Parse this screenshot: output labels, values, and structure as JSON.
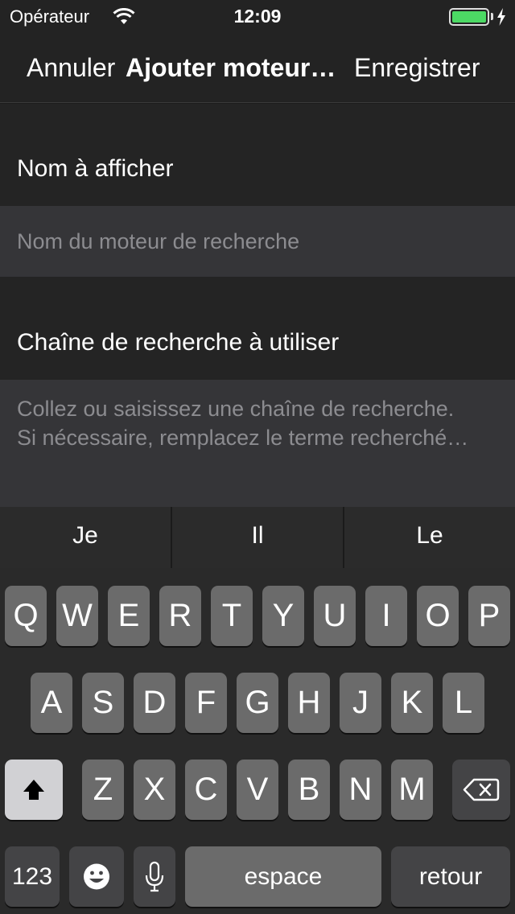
{
  "status_bar": {
    "carrier": "Opérateur",
    "time": "12:09",
    "wifi_icon": "wifi-icon",
    "battery_icon": "battery-icon",
    "charging_icon": "charging-bolt-icon",
    "battery_color": "#4cd964"
  },
  "nav": {
    "cancel_label": "Annuler",
    "title": "Ajouter moteur…",
    "save_label": "Enregistrer"
  },
  "form": {
    "name_section_label": "Nom à afficher",
    "name_placeholder": "Nom du moteur de recherche",
    "query_section_label": "Chaîne de recherche à utiliser",
    "query_placeholder_line1": "Collez ou saisissez une chaîne de recherche.",
    "query_placeholder_line2": "Si nécessaire, remplacez le terme recherché…"
  },
  "keyboard": {
    "suggestions": [
      "Je",
      "Il",
      "Le"
    ],
    "row1": [
      "Q",
      "W",
      "E",
      "R",
      "T",
      "Y",
      "U",
      "I",
      "O",
      "P"
    ],
    "row2": [
      "A",
      "S",
      "D",
      "F",
      "G",
      "H",
      "J",
      "K",
      "L"
    ],
    "row3": [
      "Z",
      "X",
      "C",
      "V",
      "B",
      "N",
      "M"
    ],
    "numbers_label": "123",
    "space_label": "espace",
    "return_label": "retour",
    "shift_icon": "shift-icon",
    "backspace_icon": "backspace-icon",
    "emoji_icon": "emoji-icon",
    "microphone_icon": "microphone-icon"
  }
}
